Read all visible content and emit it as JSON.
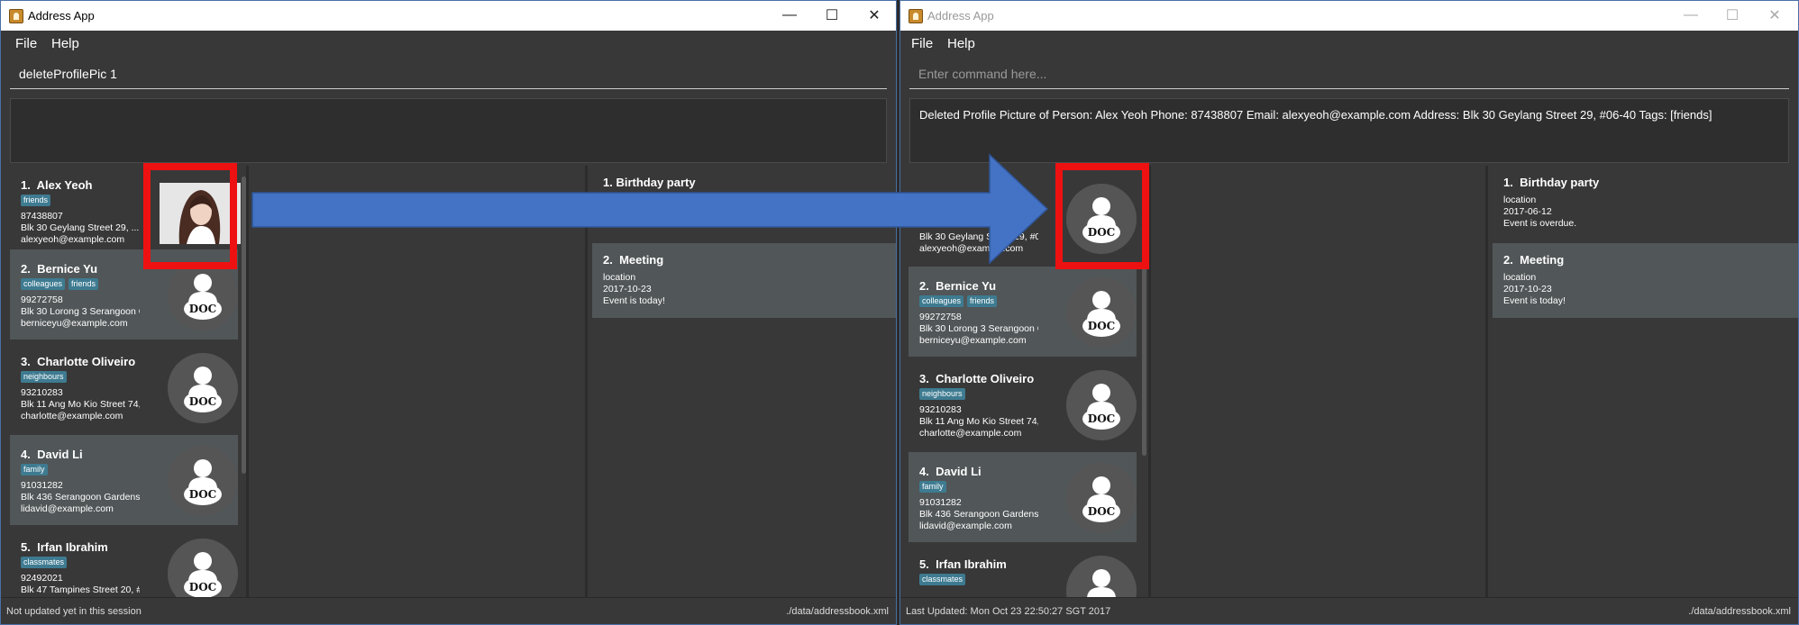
{
  "left": {
    "title": "Address App",
    "menu": [
      "File",
      "Help"
    ],
    "command": "deleteProfilePic 1",
    "result": "",
    "status_left": "Not updated yet in this session",
    "status_right": "./data/addressbook.xml",
    "persons": [
      {
        "index": "1.",
        "name": "Alex Yeoh",
        "tags": [
          "friends"
        ],
        "phone": "87438807",
        "address": "Blk 30 Geylang Street 29, ...",
        "email": "alexyeoh@example.com"
      },
      {
        "index": "2.",
        "name": "Bernice Yu",
        "tags": [
          "colleagues",
          "friends"
        ],
        "phone": "99272758",
        "address": "Blk 30 Lorong 3 Serangoon Gar...",
        "email": "berniceyu@example.com"
      },
      {
        "index": "3.",
        "name": "Charlotte Oliveiro",
        "tags": [
          "neighbours"
        ],
        "phone": "93210283",
        "address": "Blk 11 Ang Mo Kio Street 74, #...",
        "email": "charlotte@example.com"
      },
      {
        "index": "4.",
        "name": "David Li",
        "tags": [
          "family"
        ],
        "phone": "91031282",
        "address": "Blk 436 Serangoon Gardens Str...",
        "email": "lidavid@example.com"
      },
      {
        "index": "5.",
        "name": "Irfan Ibrahim",
        "tags": [
          "classmates"
        ],
        "phone": "92492021",
        "address": "Blk 47 Tampines Street 20, #17-...",
        "email": ""
      }
    ],
    "events": [
      {
        "index": "1.",
        "title": "Birthday party",
        "visible": "1. Birthday party"
      },
      {
        "index": "2.",
        "title": "Meeting",
        "location": "location",
        "date": "2017-10-23",
        "status": "Event is today!"
      }
    ]
  },
  "right": {
    "title": "Address App",
    "menu": [
      "File",
      "Help"
    ],
    "command_placeholder": "Enter command here...",
    "result": "Deleted Profile Picture of Person: Alex Yeoh Phone: 87438807 Email: alexyeoh@example.com Address: Blk 30 Geylang Street 29, #06-40 Tags: [friends]",
    "status_left": "Last Updated: Mon Oct 23 22:50:27 SGT 2017",
    "status_right": "./data/addressbook.xml",
    "persons": [
      {
        "index": "1.",
        "name": "",
        "tags": [],
        "phone": "",
        "address": "Blk 30 Geylang Street 29, #06-40",
        "email": "alexyeoh@example.com"
      },
      {
        "index": "2.",
        "name": "Bernice Yu",
        "tags": [
          "colleagues",
          "friends"
        ],
        "phone": "99272758",
        "address": "Blk 30 Lorong 3 Serangoon Gar...",
        "email": "berniceyu@example.com"
      },
      {
        "index": "3.",
        "name": "Charlotte Oliveiro",
        "tags": [
          "neighbours"
        ],
        "phone": "93210283",
        "address": "Blk 11 Ang Mo Kio Street 74, #...",
        "email": "charlotte@example.com"
      },
      {
        "index": "4.",
        "name": "David Li",
        "tags": [
          "family"
        ],
        "phone": "91031282",
        "address": "Blk 436 Serangoon Gardens Str...",
        "email": "lidavid@example.com"
      },
      {
        "index": "5.",
        "name": "Irfan Ibrahim",
        "tags": [
          "classmates"
        ],
        "phone": "",
        "address": "",
        "email": ""
      }
    ],
    "events": [
      {
        "index": "1.",
        "title": "Birthday party",
        "location": "location",
        "date": "2017-06-12",
        "status": "Event is overdue."
      },
      {
        "index": "2.",
        "title": "Meeting",
        "location": "location",
        "date": "2017-10-23",
        "status": "Event is today!"
      }
    ]
  },
  "avatar_label": "DOC",
  "colors": {
    "highlight": "#ee1111",
    "arrow": "#4472c4",
    "tag": "#3e7b91"
  }
}
